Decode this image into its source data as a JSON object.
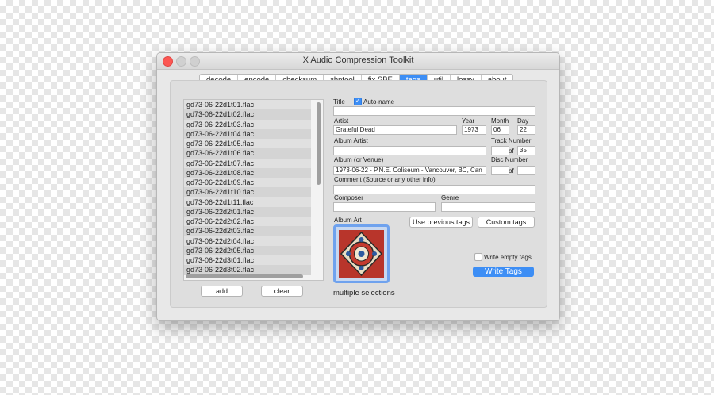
{
  "window": {
    "title": "X Audio Compression Toolkit"
  },
  "tabs": [
    {
      "label": "decode"
    },
    {
      "label": "encode"
    },
    {
      "label": "checksum"
    },
    {
      "label": "shntool"
    },
    {
      "label": "fix SBE"
    },
    {
      "label": "tags",
      "active": true
    },
    {
      "label": "util"
    },
    {
      "label": "lossy"
    },
    {
      "label": "about"
    }
  ],
  "files": [
    "gd73-06-22d1t01.flac",
    "gd73-06-22d1t02.flac",
    "gd73-06-22d1t03.flac",
    "gd73-06-22d1t04.flac",
    "gd73-06-22d1t05.flac",
    "gd73-06-22d1t06.flac",
    "gd73-06-22d1t07.flac",
    "gd73-06-22d1t08.flac",
    "gd73-06-22d1t09.flac",
    "gd73-06-22d1t10.flac",
    "gd73-06-22d1t11.flac",
    "gd73-06-22d2t01.flac",
    "gd73-06-22d2t02.flac",
    "gd73-06-22d2t03.flac",
    "gd73-06-22d2t04.flac",
    "gd73-06-22d2t05.flac",
    "gd73-06-22d3t01.flac",
    "gd73-06-22d3t02.flac"
  ],
  "buttons": {
    "add": "add",
    "clear": "clear",
    "use_previous": "Use previous tags",
    "custom": "Custom tags",
    "write": "Write Tags"
  },
  "form": {
    "title_label": "Title",
    "autoname_label": "Auto-name",
    "autoname_checked": true,
    "title_value": "",
    "artist_label": "Artist",
    "artist_value": "Grateful Dead",
    "year_label": "Year",
    "year_value": "1973",
    "month_label": "Month",
    "month_value": "06",
    "day_label": "Day",
    "day_value": "22",
    "album_artist_label": "Album Artist",
    "album_artist_value": "",
    "track_number_label": "Track Number",
    "track_number_value": "",
    "of_label": "of",
    "track_total_value": "35",
    "album_label": "Album (or Venue)",
    "album_value": "1973-06-22 - P.N.E. Coliseum - Vancouver, BC, Can",
    "disc_number_label": "Disc Number",
    "disc_number_value": "",
    "disc_total_value": "",
    "comment_label": "Comment (Source or any other info)",
    "comment_value": "",
    "composer_label": "Composer",
    "composer_value": "",
    "genre_label": "Genre",
    "genre_value": "",
    "album_art_label": "Album Art",
    "write_empty_label": "Write empty tags",
    "write_empty_checked": false,
    "selection_status": "multiple selections"
  },
  "colors": {
    "accent": "#3d8ef5",
    "close": "#fc5753"
  },
  "icons": {
    "art": "album-art-image"
  }
}
